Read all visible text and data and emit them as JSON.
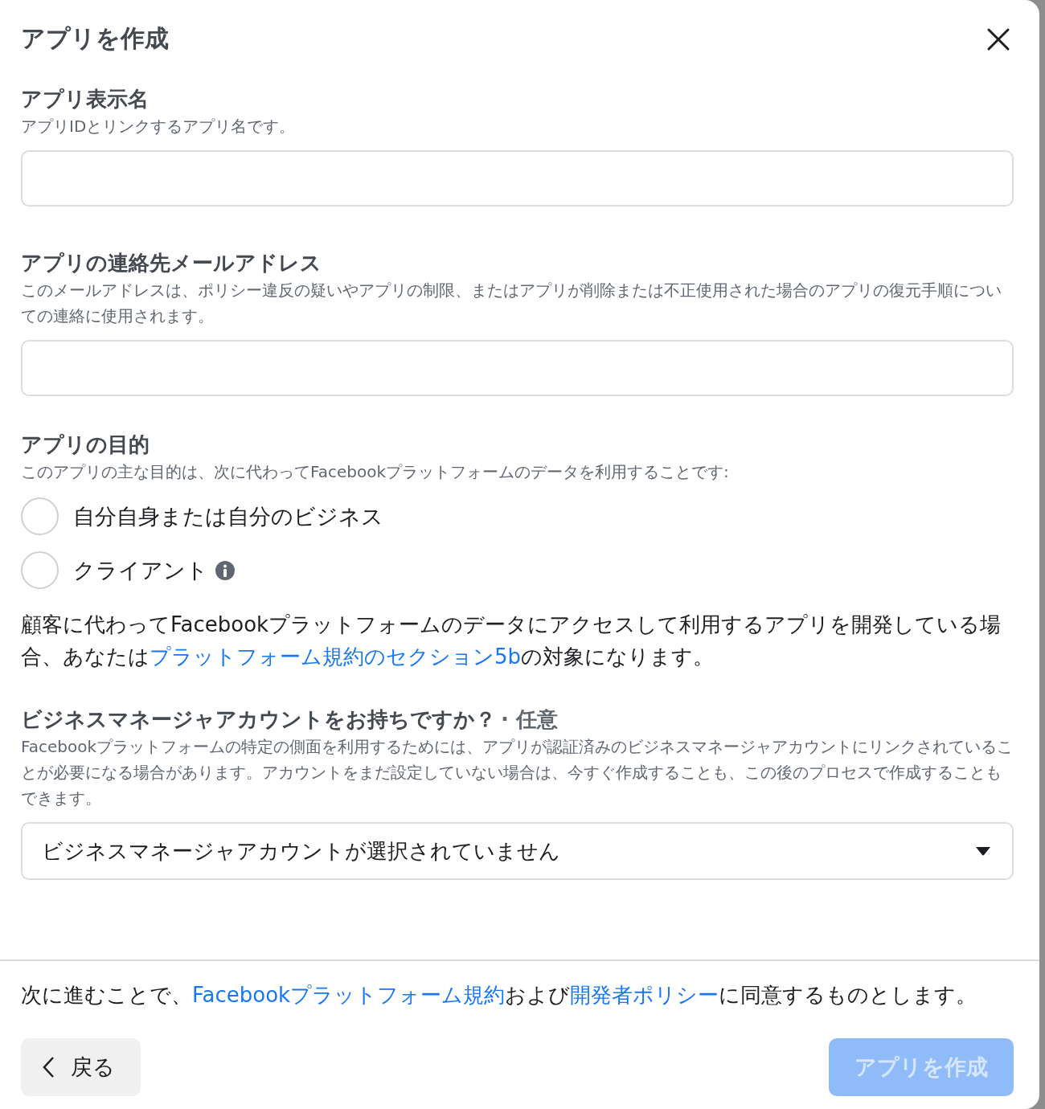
{
  "dialog": {
    "title": "アプリを作成"
  },
  "fields": [
    {
      "label": "アプリ表示名",
      "help": "アプリIDとリンクするアプリ名です。"
    },
    {
      "label": "アプリの連絡先メールアドレス",
      "help": "このメールアドレスは、ポリシー違反の疑いやアプリの制限、またはアプリが削除または不正使用された場合のアプリの復元手順についての連絡に使用されます。"
    }
  ],
  "purpose": {
    "label": "アプリの目的",
    "help": "このアプリの主な目的は、次に代わってFacebookプラットフォームのデータを利用することです:",
    "options": [
      {
        "label": "自分自身または自分のビジネス",
        "selected": false,
        "info": false
      },
      {
        "label": "クライアント",
        "selected": false,
        "info": true
      }
    ]
  },
  "notice": [
    {
      "kind": "text",
      "text": "顧客に代わってFacebookプラットフォームのデータにアクセスして利用するアプリを開発している場合、あなたは"
    },
    {
      "kind": "link",
      "text": "プラットフォーム規約のセクション5b"
    },
    {
      "kind": "text",
      "text": "の対象になります。"
    }
  ],
  "business": {
    "label": "ビジネスマネージャアカウントをお持ちですか？",
    "optional": "· 任意",
    "help": "Facebookプラットフォームの特定の側面を利用するためには、アプリが認証済みのビジネスマネージャアカウントにリンクされていることが必要になる場合があります。アカウントをまだ設定していない場合は、今すぐ作成することも、この後のプロセスで作成することもできます。",
    "select": "ビジネスマネージャアカウントが選択されていません"
  },
  "agreement": [
    {
      "kind": "text",
      "text": "次に進むことで、"
    },
    {
      "kind": "link",
      "text": "Facebookプラットフォーム規約"
    },
    {
      "kind": "text",
      "text": "および"
    },
    {
      "kind": "link",
      "text": "開発者ポリシー"
    },
    {
      "kind": "text",
      "text": "に同意するものとします。"
    }
  ],
  "buttons": {
    "back": {
      "label": "戻る"
    },
    "create": {
      "label": "アプリを作成",
      "disabled": true
    }
  }
}
